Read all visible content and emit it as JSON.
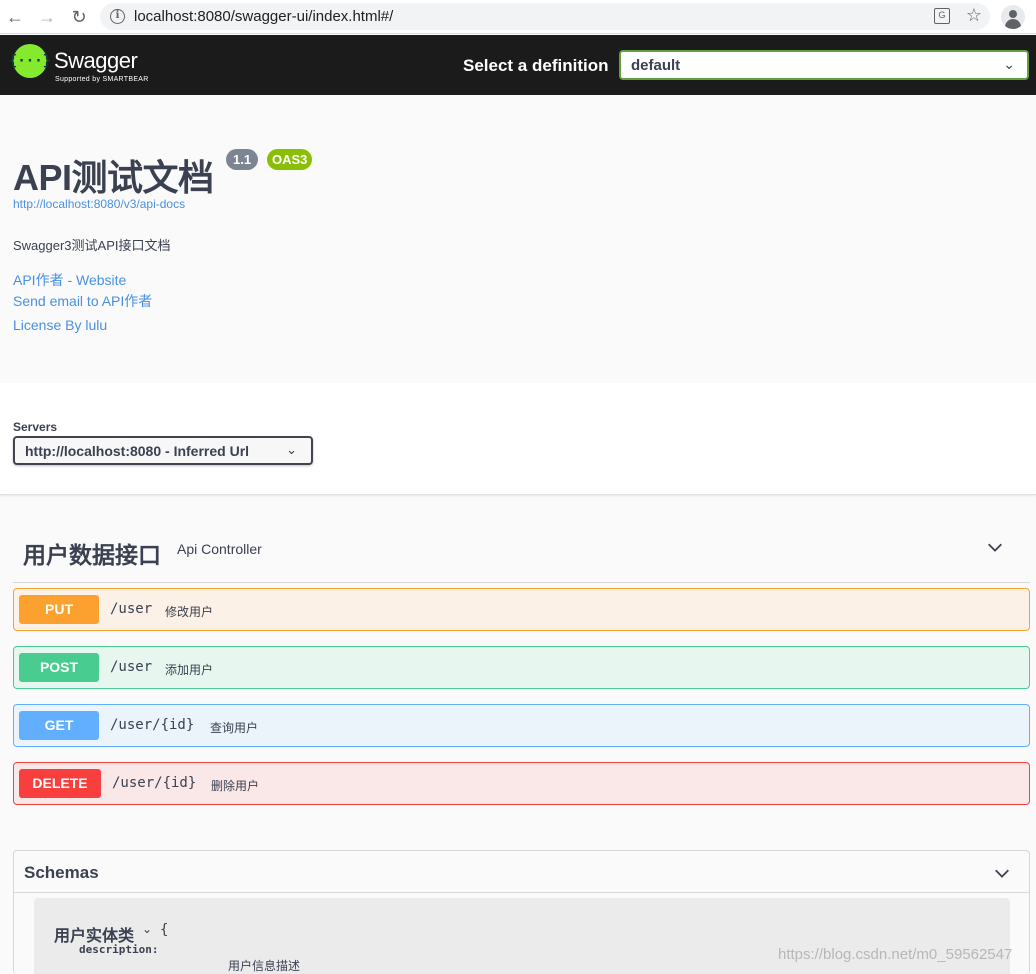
{
  "browser": {
    "url": "localhost:8080/swagger-ui/index.html#/",
    "info_icon": "info-icon",
    "translate_icon": "translate-icon",
    "star_icon": "star-icon",
    "profile_icon": "profile-icon"
  },
  "topbar": {
    "logo_glyph": "{···}",
    "logo_title": "Swagger",
    "logo_sub": "Supported by SMARTBEAR",
    "definition_label": "Select a definition",
    "definition_value": "default"
  },
  "info": {
    "title": "API测试文档",
    "version": "1.1",
    "oas": "OAS3",
    "url": "http://localhost:8080/v3/api-docs",
    "description": "Swagger3测试API接口文档",
    "link_website": "API作者 - Website",
    "link_email": "Send email to API作者",
    "link_license": "License By lulu"
  },
  "servers": {
    "label": "Servers",
    "selected": "http://localhost:8080 - Inferred Url"
  },
  "tag": {
    "name": "用户数据接口",
    "description": "Api Controller"
  },
  "operations": [
    {
      "method": "PUT",
      "path": "/user",
      "summary": "修改用户"
    },
    {
      "method": "POST",
      "path": "/user",
      "summary": "添加用户"
    },
    {
      "method": "GET",
      "path": "/user/{id}",
      "summary": "查询用户"
    },
    {
      "method": "DELETE",
      "path": "/user/{id}",
      "summary": "删除用户"
    }
  ],
  "schemas": {
    "title": "Schemas",
    "model_name": "用户实体类",
    "model_brace": "{",
    "field_label": "description:",
    "field_value": "用户信息描述"
  },
  "watermark": "https://blog.csdn.net/m0_59562547",
  "colors": {
    "put": "#fca130",
    "post": "#49cc90",
    "get": "#61affe",
    "delete": "#f93e3e",
    "swagger_green": "#85ea2d"
  }
}
